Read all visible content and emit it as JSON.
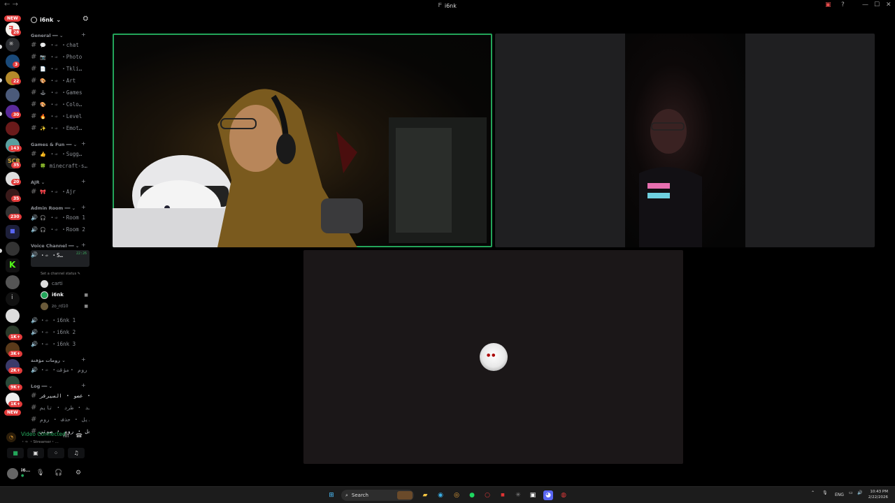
{
  "window": {
    "title": "i6nk",
    "back_icon": "back-arrow-icon"
  },
  "servers": {
    "new_badge_top": "NEW",
    "badges": [
      "28",
      "3",
      "22",
      "30",
      "143",
      "35",
      "20",
      "35",
      "230",
      "1K+",
      "3K+",
      "2K+",
      "9K+",
      "1K+"
    ],
    "new_badge_bottom": "NEW"
  },
  "guild": {
    "name": "i6nk",
    "chevron": "⌄"
  },
  "categories": {
    "general": "General ━━ ⌄",
    "games_fun": "Games & Fun ━━ ⌄",
    "ajr": "AJR ⌄",
    "admin_room": "Admin Room ━━ ⌄",
    "voice_channels": "Voice Channel ━━ ⌄",
    "temp_rooms": "رومات مؤقتة ⌄",
    "log": "Log ━━ ⌄"
  },
  "channels": {
    "chat": "・➾ ・chat",
    "photo": "・➾ ・Photo",
    "tklil": "・➾ ・Tkli…",
    "art": "・➾ ・Art",
    "games": "・➾ ・Games",
    "colors": "・➾ ・Colo…",
    "level": "・➾ ・Level",
    "emoji": "・➾ ・Emot…",
    "suggest": "・➾ ・Sugg…",
    "minecraft": "minecraft-s…",
    "ajr": "・➾ ・Ajr",
    "room1": "・➾ ・Room 1",
    "room2": "・➾ ・Room 2",
    "streamer": "・➾ ・S…",
    "i6nk1": "・➾ ・i6nk 1",
    "i6nk2": "・➾ ・i6nk 2",
    "i6nk3": "・➾ ・i6nk 3",
    "temp_room": "・➾ ・روم ・مؤقت",
    "log1": "سجل ・ عضو ・ السيرفر",
    "log2": "باند ・ طرد ・ تايم",
    "log3": "تعديل ・ حذف ・ روم",
    "log4": "سجل ・ روم ・ صوتي"
  },
  "active_channel": {
    "timer": "22:26",
    "status_hint": "Set a channel status ✎"
  },
  "voice_users": [
    {
      "name": "carti"
    },
    {
      "name": "i6nk"
    },
    {
      "name": "zo_rd10"
    }
  ],
  "voice_panel": {
    "status": "Video Connected",
    "channel": "・➾ ・Streamer・…"
  },
  "user_panel": {
    "name": "i6…",
    "status": "●"
  },
  "taskbar": {
    "search_placeholder": "Search",
    "language": "ENG",
    "time": "10:43 PM",
    "date": "2/22/2026"
  },
  "colors": {
    "accent_green": "#23a55a",
    "badge_red": "#e23a3a",
    "tile_gray": "#1f1f21"
  }
}
